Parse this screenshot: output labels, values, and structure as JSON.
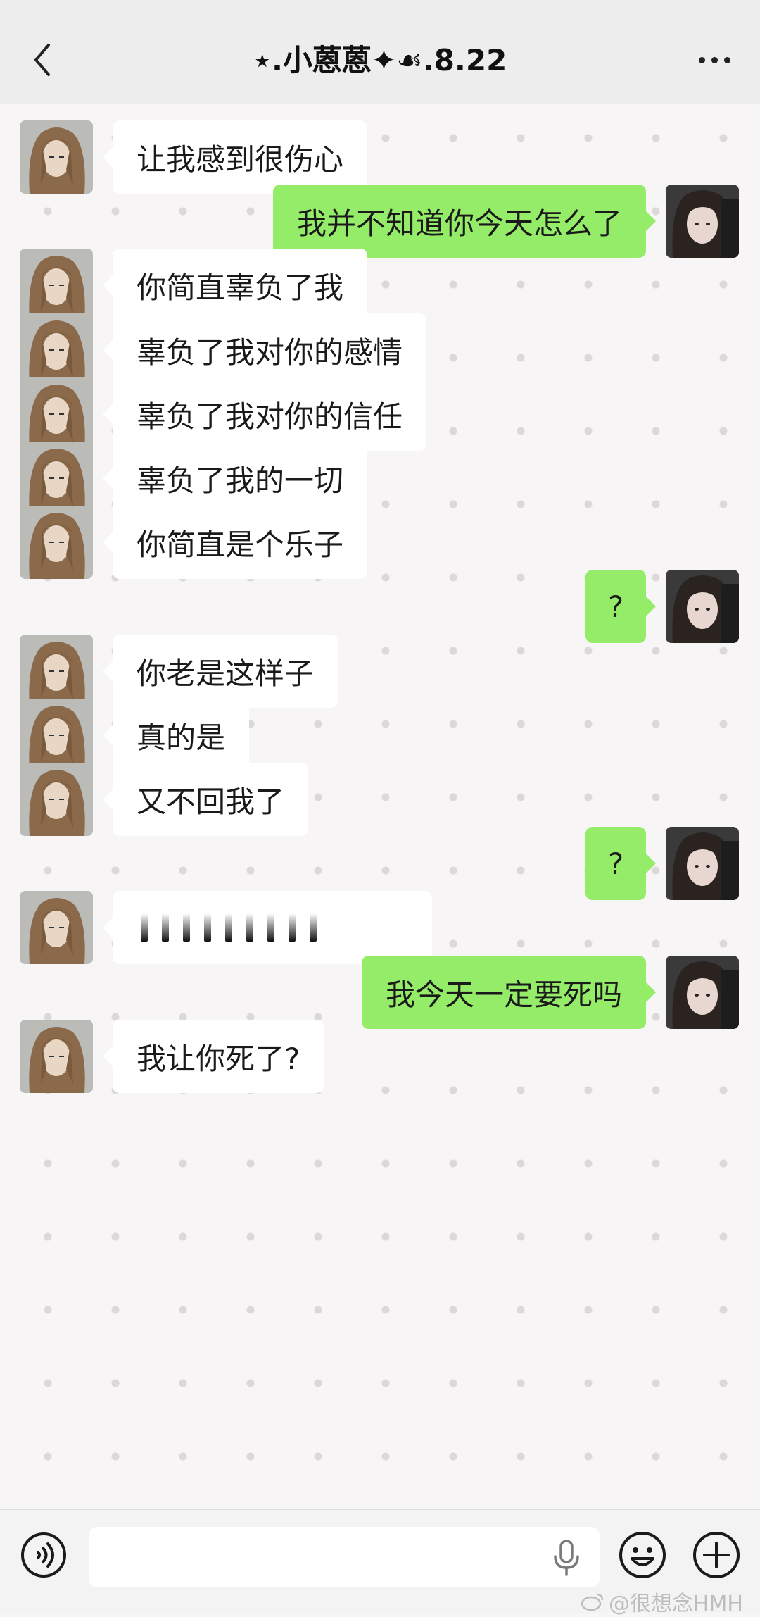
{
  "header": {
    "title": "⋆.小蒽蒽✦☙.8.22"
  },
  "messages": [
    {
      "side": "left",
      "text": "让我感到很伤心"
    },
    {
      "side": "right",
      "text": "我并不知道你今天怎么了"
    },
    {
      "side": "left",
      "text": "你简直辜负了我"
    },
    {
      "side": "left",
      "text": "辜负了我对你的感情"
    },
    {
      "side": "left",
      "text": "辜负了我对你的信任"
    },
    {
      "side": "left",
      "text": "辜负了我的一切"
    },
    {
      "side": "left",
      "text": "你简直是个乐子"
    },
    {
      "side": "right",
      "text": "?"
    },
    {
      "side": "left",
      "text": "你老是这样子"
    },
    {
      "side": "left",
      "text": "真的是"
    },
    {
      "side": "left",
      "text": "又不回我了"
    },
    {
      "side": "right",
      "text": "?"
    },
    {
      "side": "left",
      "type": "voice-bars"
    },
    {
      "side": "right",
      "text": "我今天一定要死吗"
    },
    {
      "side": "left",
      "text": "我让你死了?"
    }
  ],
  "input": {
    "placeholder": ""
  },
  "watermark": {
    "text": "@很想念HMH"
  },
  "colors": {
    "sent_bubble": "#95ec69",
    "received_bubble": "#ffffff",
    "header_bg": "#ededed"
  },
  "icons": {
    "back": "chevron-left-icon",
    "more": "more-dots-icon",
    "voice": "voice-toggle-icon",
    "mic": "microphone-icon",
    "emoji": "emoji-icon",
    "plus": "plus-icon"
  }
}
